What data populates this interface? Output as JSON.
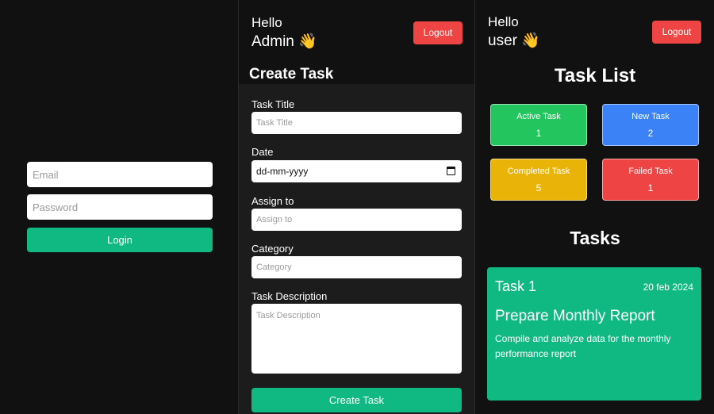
{
  "login": {
    "email_placeholder": "Email",
    "password_placeholder": "Password",
    "login_label": "Login"
  },
  "admin": {
    "hello": "Hello",
    "name": "Admin 👋",
    "logout_label": "Logout",
    "create_task_title": "Create Task",
    "fields": {
      "task_title_label": "Task Title",
      "task_title_placeholder": "Task Title",
      "date_label": "Date",
      "date_value": "dd-mm-yyyy",
      "assign_label": "Assign to",
      "assign_placeholder": "Assign to",
      "category_label": "Category",
      "category_placeholder": "Category",
      "description_label": "Task Description",
      "description_placeholder": "Task Description"
    },
    "create_button_label": "Create Task"
  },
  "user": {
    "hello": "Hello",
    "name": "user 👋",
    "logout_label": "Logout",
    "task_list_title": "Task List",
    "stats": {
      "active": {
        "label": "Active Task",
        "count": "1"
      },
      "new": {
        "label": "New Task",
        "count": "2"
      },
      "completed": {
        "label": "Completed Task",
        "count": "5"
      },
      "failed": {
        "label": "Failed Task",
        "count": "1"
      }
    },
    "tasks_title": "Tasks",
    "task": {
      "number": "Task 1",
      "date": "20 feb 2024",
      "title": "Prepare Monthly Report",
      "description": "Compile and analyze data for the monthly performance report"
    }
  },
  "colors": {
    "accent": "#10b981",
    "logout": "#ef4444",
    "active": "#22c55e",
    "new": "#3b82f6",
    "completed": "#eab308",
    "failed": "#ef4444"
  }
}
